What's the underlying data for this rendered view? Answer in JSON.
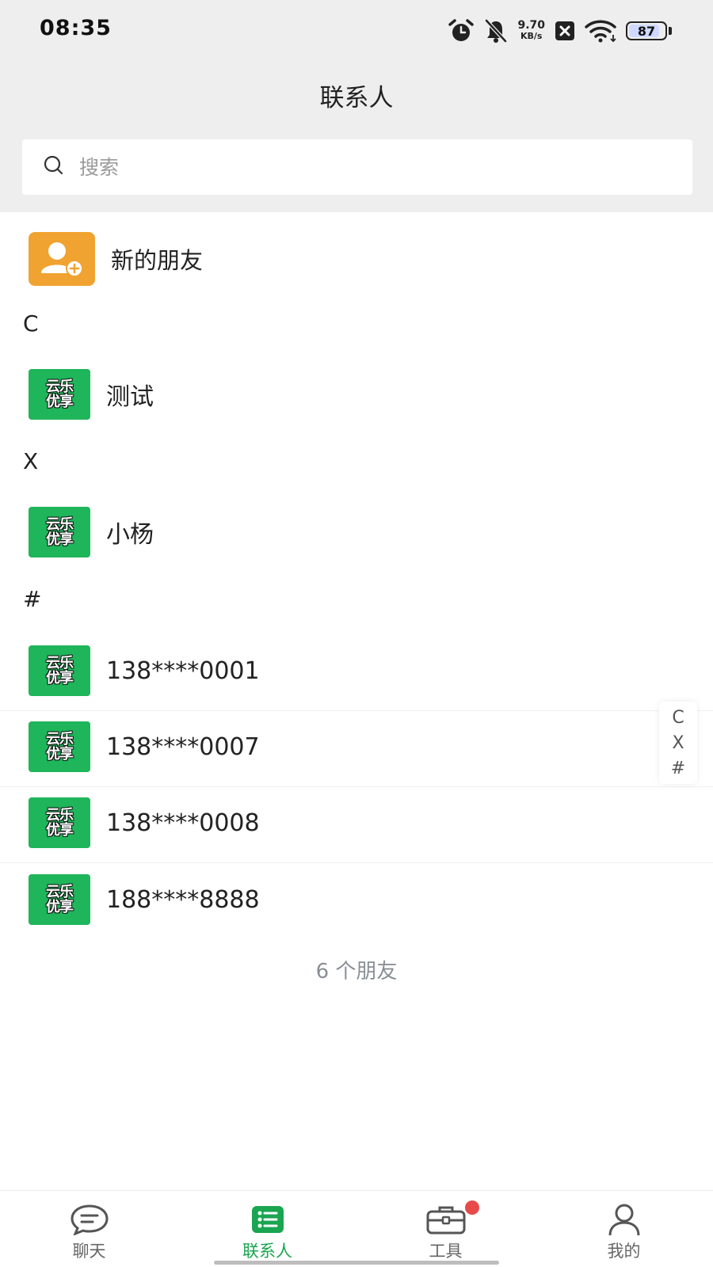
{
  "status_bar": {
    "time": "08:35",
    "net_speed_value": "9.70",
    "net_speed_unit": "KB/s",
    "battery": "87",
    "battery_level": 0.87,
    "icons": [
      "alarm-icon",
      "mute-bell-icon",
      "x-box-icon",
      "wifi-icon",
      "battery-icon"
    ]
  },
  "header": {
    "title": "联系人"
  },
  "search": {
    "placeholder": "搜索",
    "value": ""
  },
  "new_friend": {
    "label": "新的朋友",
    "icon": "add-user-icon",
    "color": "#F0A330"
  },
  "sections": [
    {
      "letter": "C",
      "contacts": [
        {
          "name": "测试",
          "avatar_text": [
            "云乐",
            "优享"
          ]
        }
      ]
    },
    {
      "letter": "X",
      "contacts": [
        {
          "name": "小杨",
          "avatar_text": [
            "云乐",
            "优享"
          ]
        }
      ]
    },
    {
      "letter": "#",
      "contacts": [
        {
          "name": "138****0001",
          "avatar_text": [
            "云乐",
            "优享"
          ]
        },
        {
          "name": "138****0007",
          "avatar_text": [
            "云乐",
            "优享"
          ]
        },
        {
          "name": "138****0008",
          "avatar_text": [
            "云乐",
            "优享"
          ]
        },
        {
          "name": "188****8888",
          "avatar_text": [
            "云乐",
            "优享"
          ]
        }
      ]
    }
  ],
  "friend_count": "6 个朋友",
  "index_bar": [
    "C",
    "X",
    "#"
  ],
  "tabs": [
    {
      "label": "聊天",
      "icon": "chat-bubble-icon",
      "active": false
    },
    {
      "label": "联系人",
      "icon": "contacts-list-icon",
      "active": true
    },
    {
      "label": "工具",
      "icon": "toolbox-icon",
      "active": false,
      "badge": true
    },
    {
      "label": "我的",
      "icon": "profile-icon",
      "active": false
    }
  ],
  "colors": {
    "accent": "#1AA550",
    "avatar_bg": "#1FB55A",
    "badge": "#E84A4A",
    "header_bg": "#EEEEEE"
  }
}
